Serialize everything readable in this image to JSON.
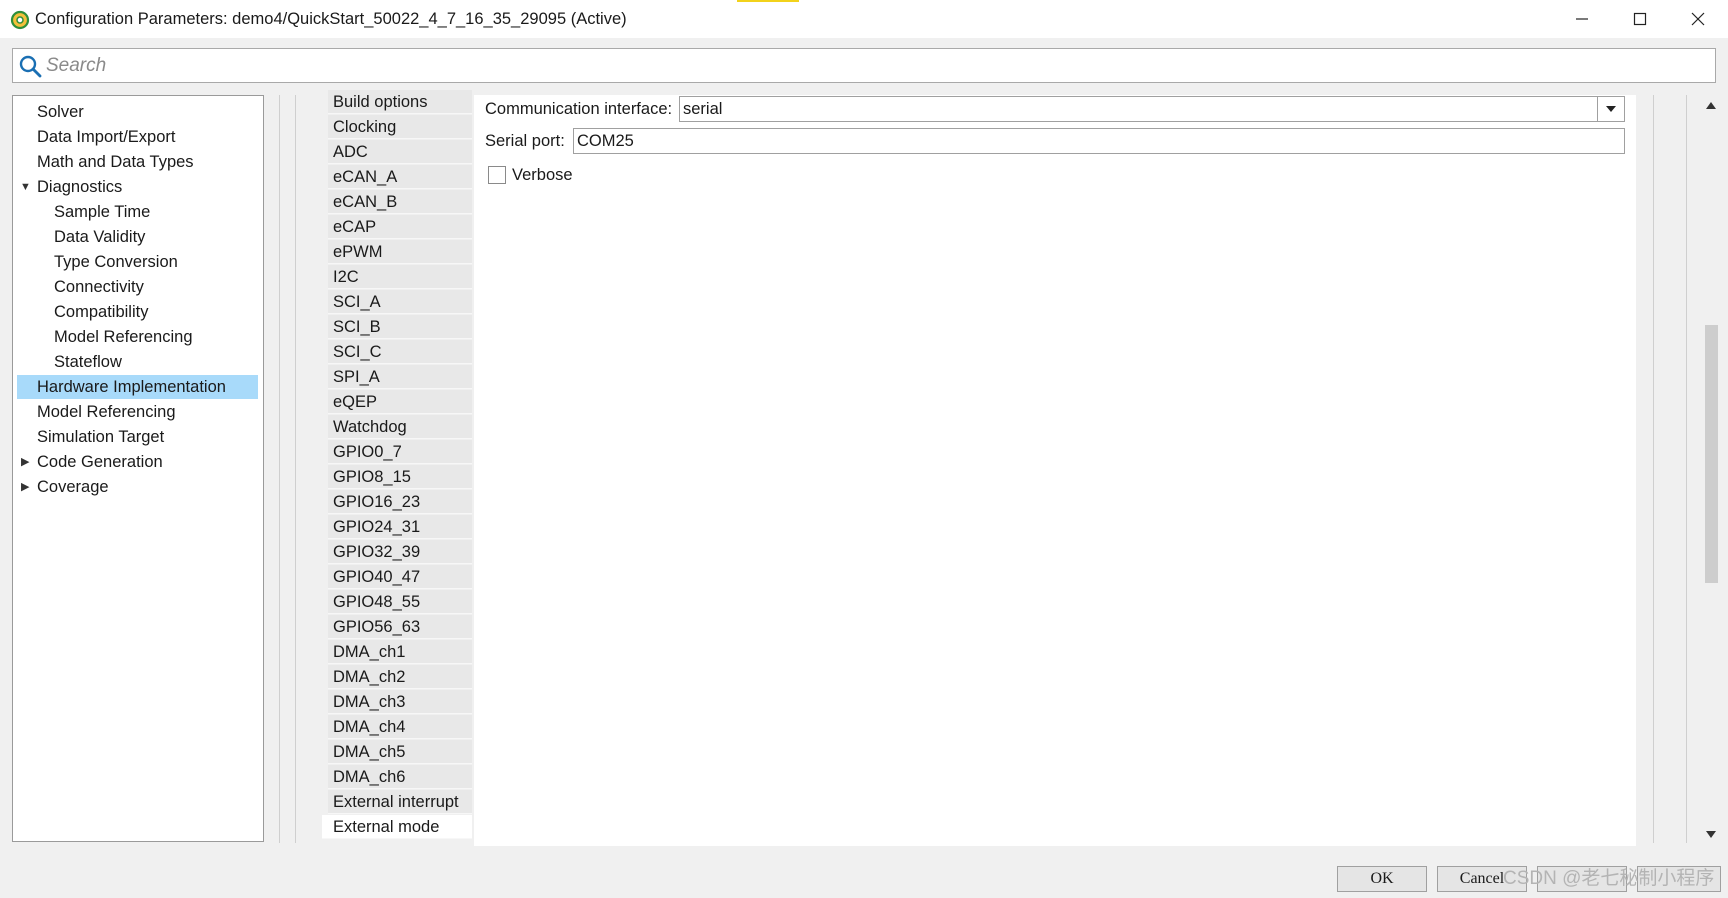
{
  "window": {
    "title": "Configuration Parameters: demo4/QuickStart_50022_4_7_16_35_29095 (Active)"
  },
  "search": {
    "placeholder": "Search"
  },
  "tree": {
    "items": [
      {
        "label": "Solver"
      },
      {
        "label": "Data Import/Export"
      },
      {
        "label": "Math and Data Types"
      },
      {
        "label": "Diagnostics",
        "expanded": true
      },
      {
        "label": "Sample Time"
      },
      {
        "label": "Data Validity"
      },
      {
        "label": "Type Conversion"
      },
      {
        "label": "Connectivity"
      },
      {
        "label": "Compatibility"
      },
      {
        "label": "Model Referencing"
      },
      {
        "label": "Stateflow"
      },
      {
        "label": "Hardware Implementation",
        "selected": true
      },
      {
        "label": "Model Referencing"
      },
      {
        "label": "Simulation Target"
      },
      {
        "label": "Code Generation",
        "expanded": false
      },
      {
        "label": "Coverage",
        "expanded": false
      }
    ]
  },
  "subtabs": {
    "items": [
      "Build options",
      "Clocking",
      "ADC",
      "eCAN_A",
      "eCAN_B",
      "eCAP",
      "ePWM",
      "I2C",
      "SCI_A",
      "SCI_B",
      "SCI_C",
      "SPI_A",
      "eQEP",
      "Watchdog",
      "GPIO0_7",
      "GPIO8_15",
      "GPIO16_23",
      "GPIO24_31",
      "GPIO32_39",
      "GPIO40_47",
      "GPIO48_55",
      "GPIO56_63",
      "DMA_ch1",
      "DMA_ch2",
      "DMA_ch3",
      "DMA_ch4",
      "DMA_ch5",
      "DMA_ch6",
      "External interrupt",
      "External mode"
    ],
    "active": "External mode"
  },
  "content": {
    "comm_label": "Communication interface:",
    "comm_value": "serial",
    "port_label": "Serial port:",
    "port_value": "COM25",
    "verbose_label": "Verbose",
    "verbose_checked": false
  },
  "buttons": {
    "ok": "OK",
    "cancel": "Cancel"
  },
  "watermark": "CSDN @老七秘制小程序",
  "colors": {
    "selection": "#a8dafa",
    "accent": "#f2d21b"
  }
}
